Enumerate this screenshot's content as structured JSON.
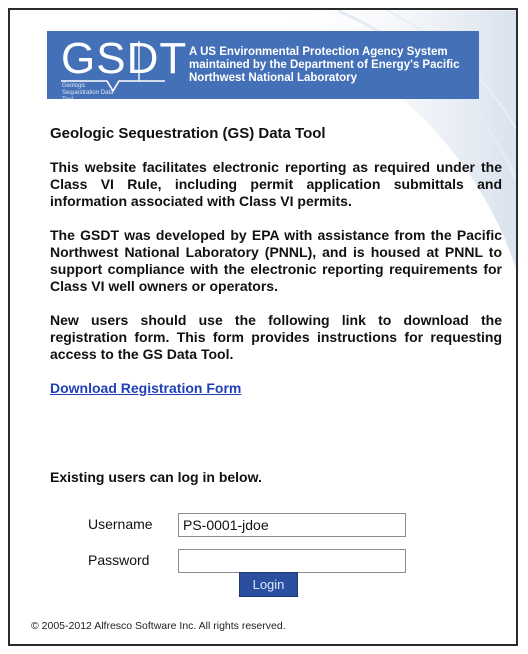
{
  "header": {
    "logo": "GSDT",
    "logo_subtitle": "Geologic Sequestration Data Tool",
    "description": "A US Environmental Protection Agency System maintained by the Department of Energy's Pacific Northwest National Laboratory"
  },
  "main": {
    "title": "Geologic Sequestration (GS) Data Tool",
    "paragraphs": [
      "This website facilitates electronic reporting as required under the Class VI Rule, including permit application submittals and information associated with Class VI permits.",
      "The GSDT was developed by EPA with assistance from the Pacific Northwest National Laboratory (PNNL), and is housed at PNNL to support compliance with the electronic reporting requirements for Class VI well owners or operators.",
      "New users should use the following link to download the registration form. This form provides instructions for requesting access to the GS Data Tool."
    ],
    "download_link": "Download Registration Form"
  },
  "login": {
    "heading": "Existing users can log in below.",
    "username_label": "Username",
    "username_value": "PS-0001-jdoe",
    "password_label": "Password",
    "password_value": "",
    "button_label": "Login"
  },
  "footer": {
    "copyright": "© 2005-2012 Alfresco Software Inc. All rights reserved."
  },
  "colors": {
    "header_bg": "#4470b8",
    "button_bg": "#2a4f9e",
    "link": "#2040b8"
  }
}
